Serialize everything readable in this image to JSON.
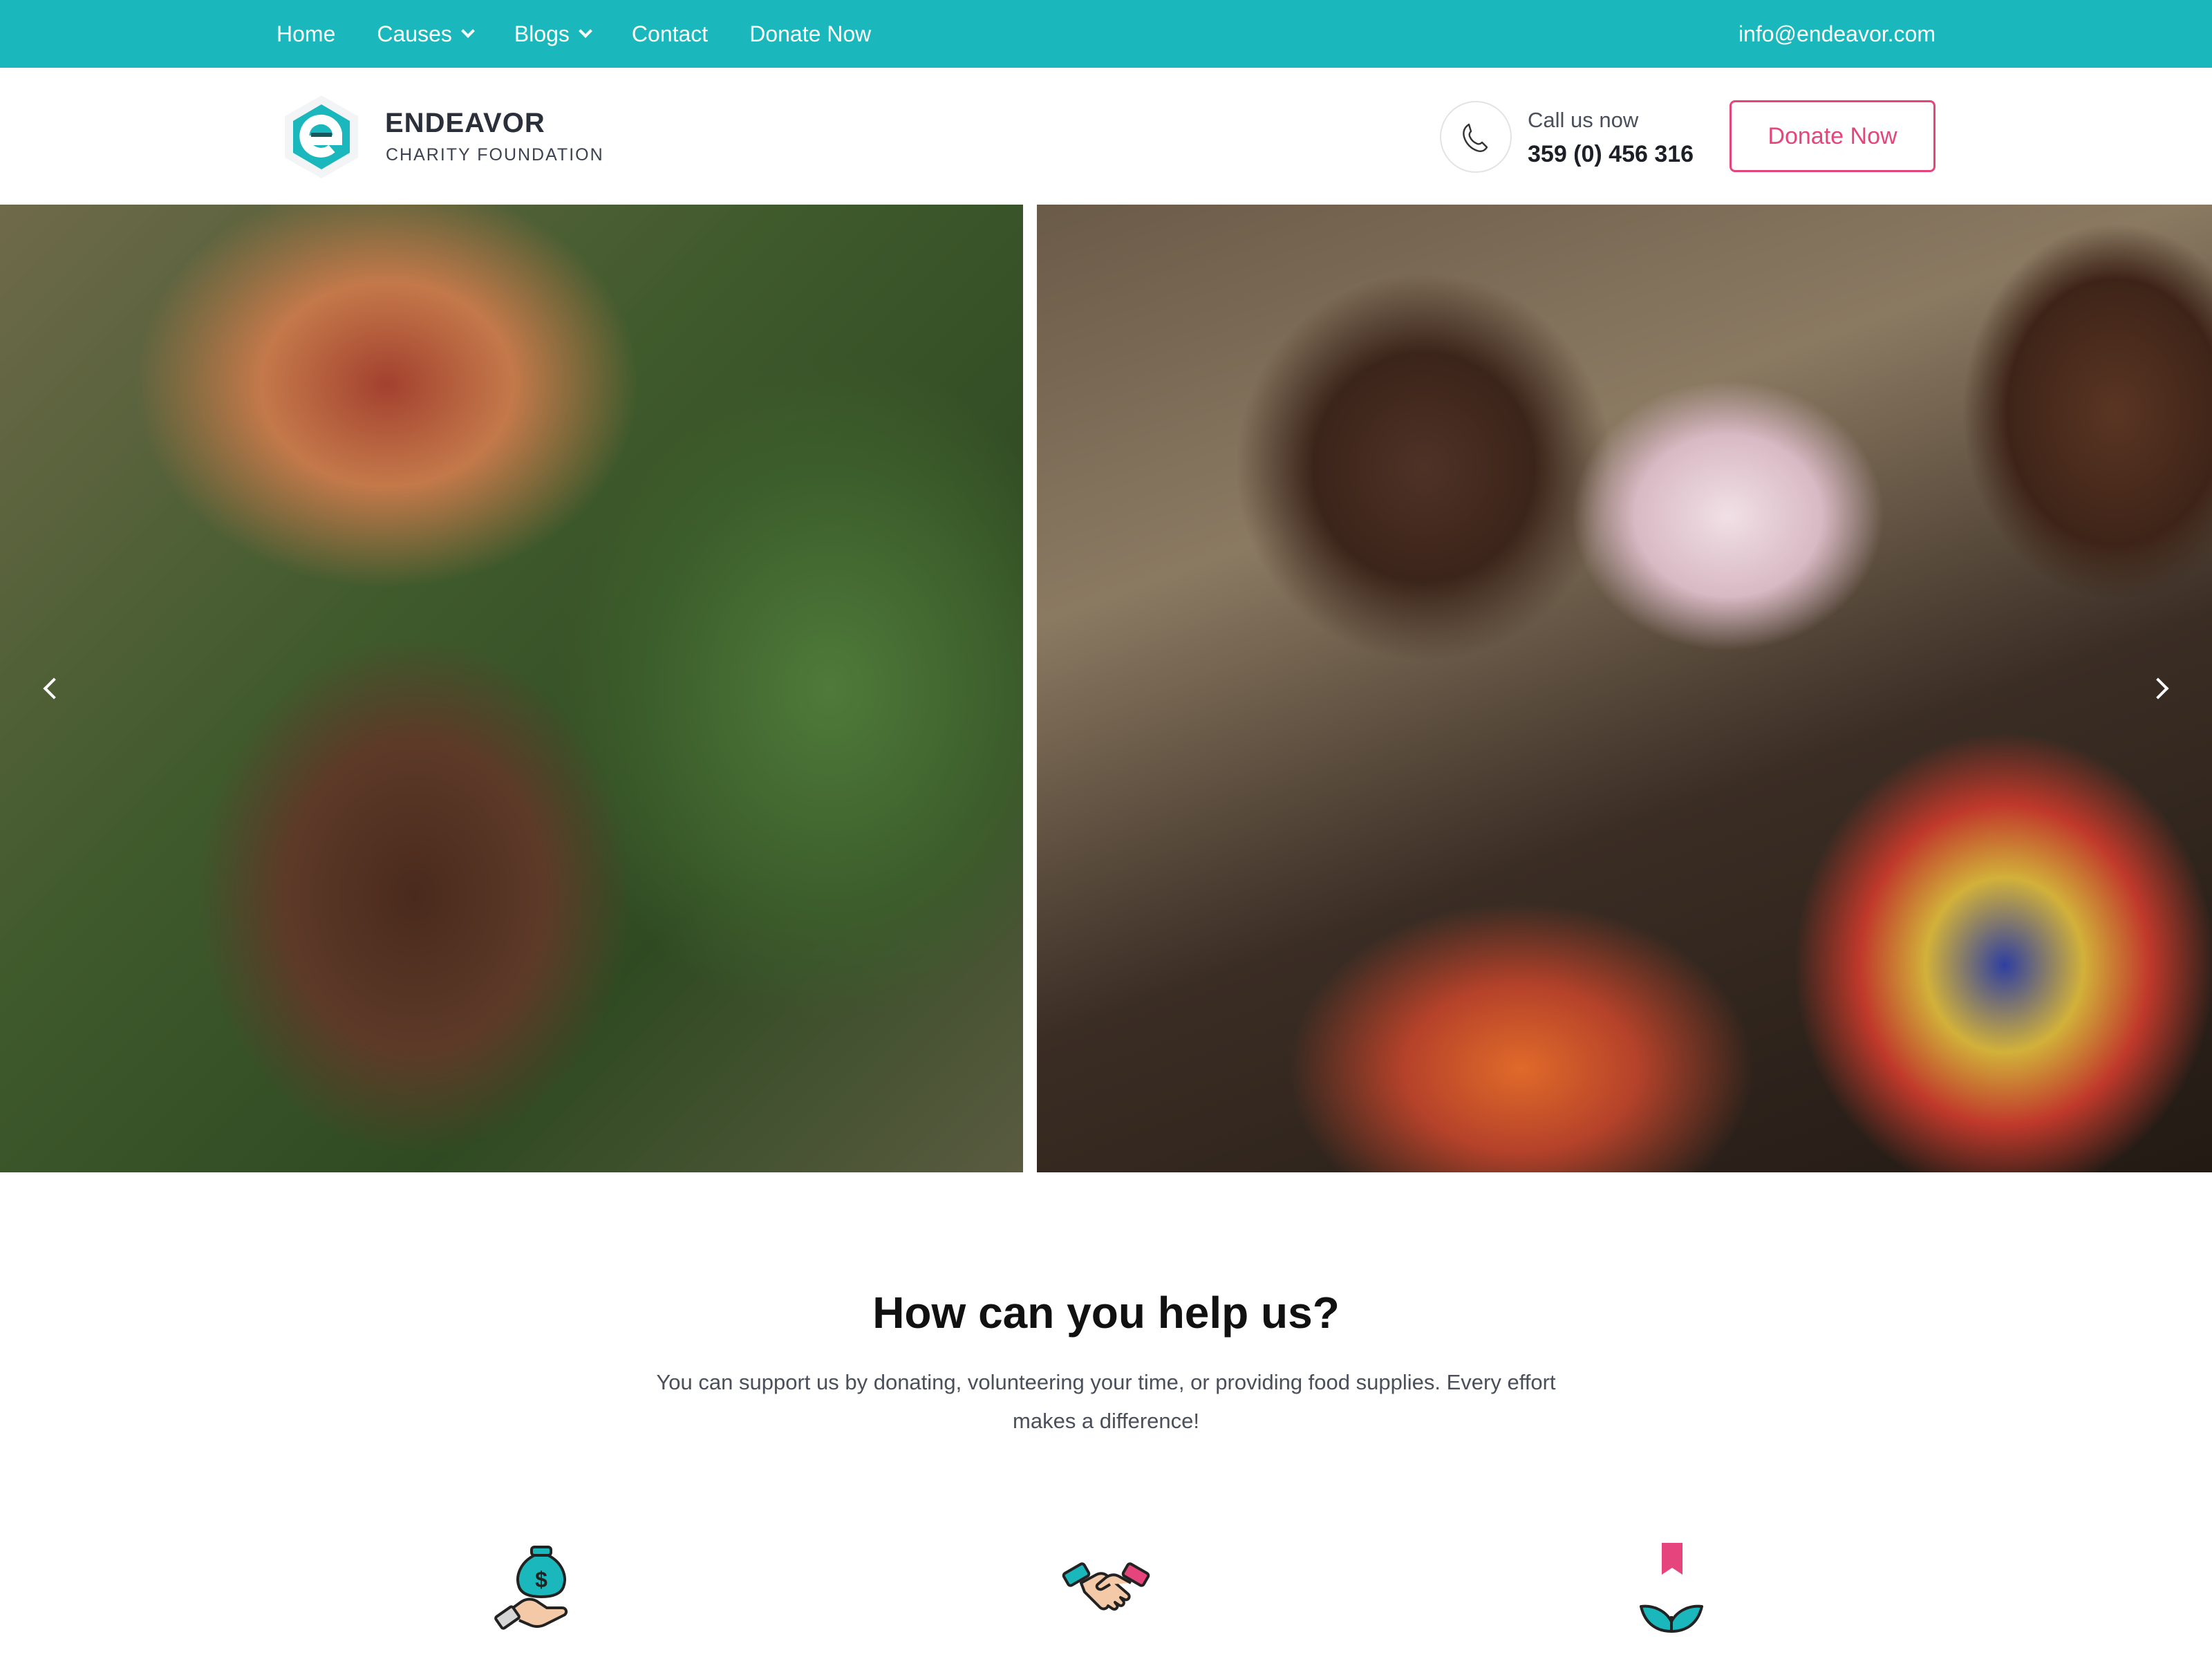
{
  "topbar": {
    "nav": [
      {
        "label": "Home",
        "has_dropdown": false
      },
      {
        "label": "Causes",
        "has_dropdown": true
      },
      {
        "label": "Blogs",
        "has_dropdown": true
      },
      {
        "label": "Contact",
        "has_dropdown": false
      },
      {
        "label": "Donate Now",
        "has_dropdown": false
      }
    ],
    "email": "info@endeavor.com",
    "background_color": "#1ab7bc"
  },
  "header": {
    "brand_name": "ENDEAVOR",
    "brand_sub": "CHARITY FOUNDATION",
    "call_label": "Call us now",
    "call_number": "359 (0) 456 316",
    "donate_label": "Donate Now",
    "accent_color": "#e5457c",
    "logo_icon": "endeavor-e-logo",
    "phone_icon": "phone-icon"
  },
  "hero": {
    "prev_icon": "chevron-left-icon",
    "next_icon": "chevron-right-icon"
  },
  "help": {
    "title": "How can you help us?",
    "description": "You can support us by donating, volunteering your time, or providing food supplies. Every effort makes a difference!",
    "icons": [
      "money-bag-hand-icon",
      "handshake-icon",
      "bookmark-leaf-icon"
    ]
  }
}
